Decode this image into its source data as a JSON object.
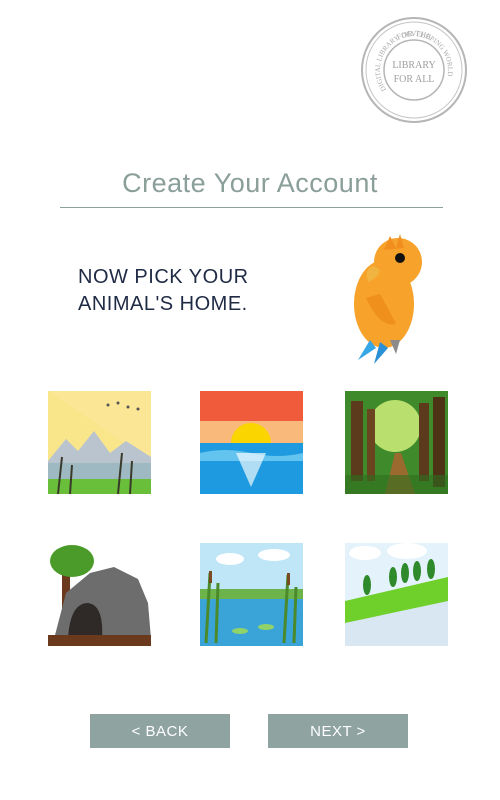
{
  "seal": {
    "ring_top": "FOR THE",
    "ring_right": "DEVELOPING WORLD",
    "ring_left": "DIGITAL LIBRARY",
    "center_line1": "LIBRARY",
    "center_line2": "FOR ALL"
  },
  "header": {
    "title": "Create Your Account"
  },
  "instruction": "NOW PICK YOUR\nANIMAL'S HOME.",
  "habitats": [
    {
      "id": "mountain-lake",
      "icon": "mountain-lake-icon"
    },
    {
      "id": "ocean-sunset",
      "icon": "ocean-sunset-icon"
    },
    {
      "id": "forest-path",
      "icon": "forest-path-icon"
    },
    {
      "id": "cave",
      "icon": "cave-icon"
    },
    {
      "id": "pond-reeds",
      "icon": "pond-reeds-icon"
    },
    {
      "id": "river-meadow",
      "icon": "river-meadow-icon"
    }
  ],
  "nav": {
    "back_label": "< BACK",
    "next_label": "NEXT >"
  },
  "colors": {
    "accent": "#8fa3a1",
    "title": "#8a9e9a",
    "text": "#1f2a44",
    "parrot": "#f7a22a"
  }
}
